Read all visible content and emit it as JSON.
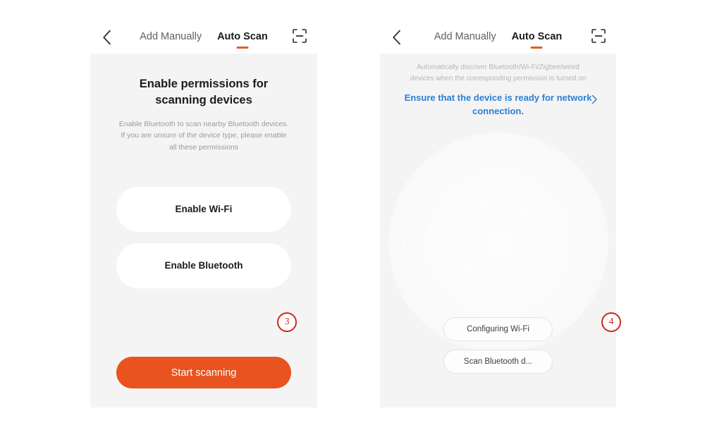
{
  "screens": [
    {
      "id": "permissions",
      "header": {
        "back_icon": "chevron-left-icon",
        "tab_manual": "Add Manually",
        "tab_auto": "Auto Scan",
        "scan_icon": "scan-frame-icon"
      },
      "title": "Enable permissions for\nscanning devices",
      "subtitle": "Enable Bluetooth to scan nearby Bluetooth devices.\nIf you are unsure of the device type, please enable\nall these permissions",
      "options": [
        {
          "label": "Enable Wi-Fi"
        },
        {
          "label": "Enable Bluetooth"
        }
      ],
      "cta_label": "Start scanning",
      "badge": "3"
    },
    {
      "id": "scanning",
      "header": {
        "back_icon": "chevron-left-icon",
        "tab_manual": "Add Manually",
        "tab_auto": "Auto Scan",
        "scan_icon": "scan-frame-icon"
      },
      "hint": "Automatically discover Bluetooth/Wi-Fi/Zigbee/wired\ndevices when the corresponding permission is turned on",
      "link_text": "Ensure that the device is ready for network connection.",
      "link_chevron": "chevron-right-icon",
      "chips": [
        {
          "label": "Configuring Wi-Fi"
        },
        {
          "label": "Scan Bluetooth d..."
        }
      ],
      "badge": "4"
    }
  ],
  "colors": {
    "accent_orange": "#e8531f",
    "tab_underline": "#ea5a22",
    "link_blue": "#2b7fd4",
    "badge_red": "#cf2a1b",
    "panel_bg": "#f4f4f4",
    "page_bg": "#ffffff"
  }
}
